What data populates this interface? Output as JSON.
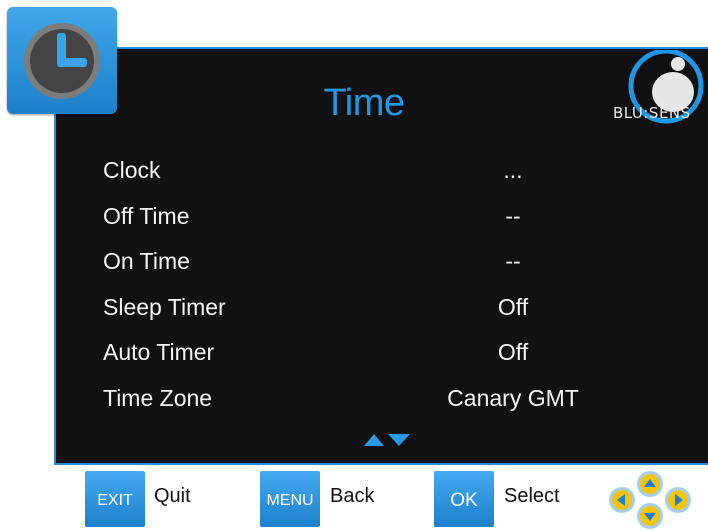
{
  "header": {
    "title": "Time",
    "brand": "BLU:SENS",
    "icon": "clock-icon"
  },
  "colors": {
    "accent": "#1e98e6",
    "panel": "#111111",
    "text": "#f4f4f4",
    "key": "#2a8fd6",
    "nav": "#f2c40e"
  },
  "menu": {
    "items": [
      {
        "label": "Clock",
        "value": "..."
      },
      {
        "label": "Off Time",
        "value": "--"
      },
      {
        "label": "On Time",
        "value": "--"
      },
      {
        "label": "Sleep Timer",
        "value": "Off"
      },
      {
        "label": "Auto Timer",
        "value": "Off"
      },
      {
        "label": "Time Zone",
        "value": "Canary GMT"
      }
    ]
  },
  "footer": {
    "exit_key": "EXIT",
    "exit_label": "Quit",
    "menu_key": "MENU",
    "menu_label": "Back",
    "ok_key": "OK",
    "ok_label": "Select",
    "nav_icon": "directional-pad-icon"
  }
}
